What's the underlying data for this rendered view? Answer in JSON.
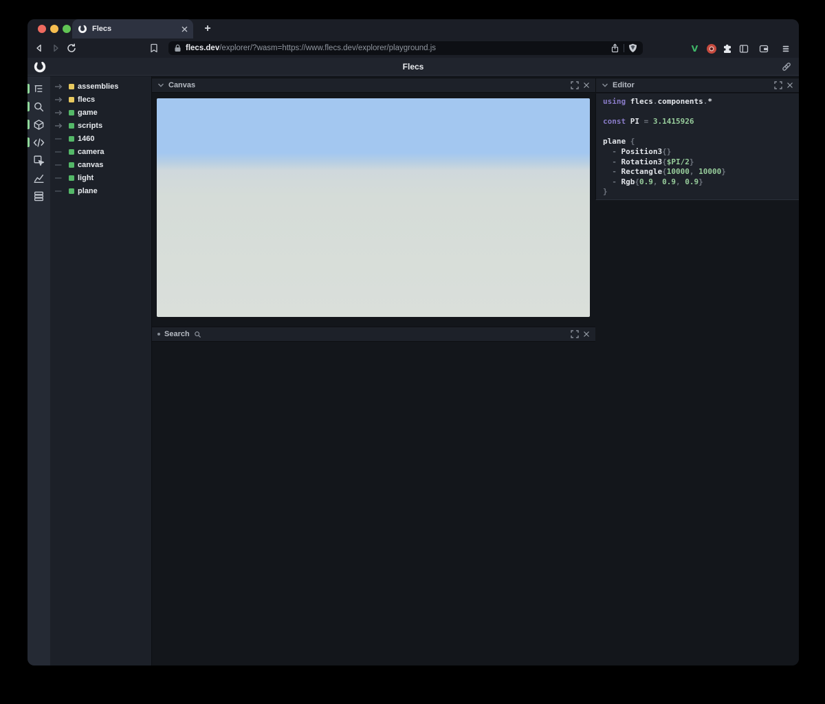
{
  "browser": {
    "tab_title": "Flecs",
    "new_tab_label": "+",
    "url_domain": "flecs.dev",
    "url_path": "/explorer/?wasm=https://www.flecs.dev/explorer/playground.js"
  },
  "app_header": {
    "title": "Flecs"
  },
  "rail": {
    "active_color": "#8fd89a",
    "icons": [
      {
        "name": "entity-tree-icon",
        "active": true
      },
      {
        "name": "search-icon",
        "active": true
      },
      {
        "name": "entities-cube-icon",
        "active": true
      },
      {
        "name": "code-editor-icon",
        "active": true
      },
      {
        "name": "inspect-icon",
        "active": false
      },
      {
        "name": "stats-chart-icon",
        "active": false
      },
      {
        "name": "queries-icon",
        "active": false
      }
    ]
  },
  "tree": {
    "items": [
      {
        "label": "assemblies",
        "kind": "module",
        "color": "#e8c95f",
        "expandable": true
      },
      {
        "label": "flecs",
        "kind": "module",
        "color": "#e8c95f",
        "expandable": true
      },
      {
        "label": "game",
        "kind": "entity",
        "color": "#54b868",
        "expandable": true
      },
      {
        "label": "scripts",
        "kind": "entity",
        "color": "#54b868",
        "expandable": true
      },
      {
        "label": "1460",
        "kind": "entity",
        "color": "#54b868",
        "expandable": false
      },
      {
        "label": "camera",
        "kind": "entity",
        "color": "#54b868",
        "expandable": false
      },
      {
        "label": "canvas",
        "kind": "entity",
        "color": "#54b868",
        "expandable": false
      },
      {
        "label": "light",
        "kind": "entity",
        "color": "#54b868",
        "expandable": false
      },
      {
        "label": "plane",
        "kind": "entity",
        "color": "#54b868",
        "expandable": false
      }
    ]
  },
  "canvas_panel": {
    "title": "Canvas",
    "sky_color": "#a3c7f0",
    "ground_color": "#d7ddd8"
  },
  "search_panel": {
    "title": "Search"
  },
  "editor_panel": {
    "title": "Editor",
    "code_lines": [
      [
        {
          "t": "using ",
          "c": "kw"
        },
        {
          "t": "flecs",
          "c": "id"
        },
        {
          "t": ".",
          "c": "pu"
        },
        {
          "t": "components",
          "c": "id"
        },
        {
          "t": ".",
          "c": "pu"
        },
        {
          "t": "*",
          "c": "id"
        }
      ],
      [],
      [
        {
          "t": "const ",
          "c": "kw"
        },
        {
          "t": "PI",
          "c": "id"
        },
        {
          "t": " = ",
          "c": "pu"
        },
        {
          "t": "3.1415926",
          "c": "num"
        }
      ],
      [],
      [
        {
          "t": "plane",
          "c": "id"
        },
        {
          "t": " {",
          "c": "pu"
        }
      ],
      [
        {
          "t": "  - ",
          "c": "pu"
        },
        {
          "t": "Position3",
          "c": "id"
        },
        {
          "t": "{}",
          "c": "pu"
        }
      ],
      [
        {
          "t": "  - ",
          "c": "pu"
        },
        {
          "t": "Rotation3",
          "c": "id"
        },
        {
          "t": "{",
          "c": "pu"
        },
        {
          "t": "$PI/2",
          "c": "num"
        },
        {
          "t": "}",
          "c": "pu"
        }
      ],
      [
        {
          "t": "  - ",
          "c": "pu"
        },
        {
          "t": "Rectangle",
          "c": "id"
        },
        {
          "t": "{",
          "c": "pu"
        },
        {
          "t": "10000",
          "c": "num"
        },
        {
          "t": ", ",
          "c": "pu"
        },
        {
          "t": "10000",
          "c": "num"
        },
        {
          "t": "}",
          "c": "pu"
        }
      ],
      [
        {
          "t": "  - ",
          "c": "pu"
        },
        {
          "t": "Rgb",
          "c": "id"
        },
        {
          "t": "{",
          "c": "pu"
        },
        {
          "t": "0.9",
          "c": "num"
        },
        {
          "t": ", ",
          "c": "pu"
        },
        {
          "t": "0.9",
          "c": "num"
        },
        {
          "t": ", ",
          "c": "pu"
        },
        {
          "t": "0.9",
          "c": "num"
        },
        {
          "t": "}",
          "c": "pu"
        }
      ],
      [
        {
          "t": "}",
          "c": "pu"
        }
      ]
    ]
  },
  "colors": {
    "keyword": "#8a7cc9",
    "identifier": "#e2e5ea",
    "number": "#97cc9b",
    "punctuation": "#6d737d",
    "module_swatch": "#e8c95f",
    "entity_swatch": "#54b868"
  }
}
